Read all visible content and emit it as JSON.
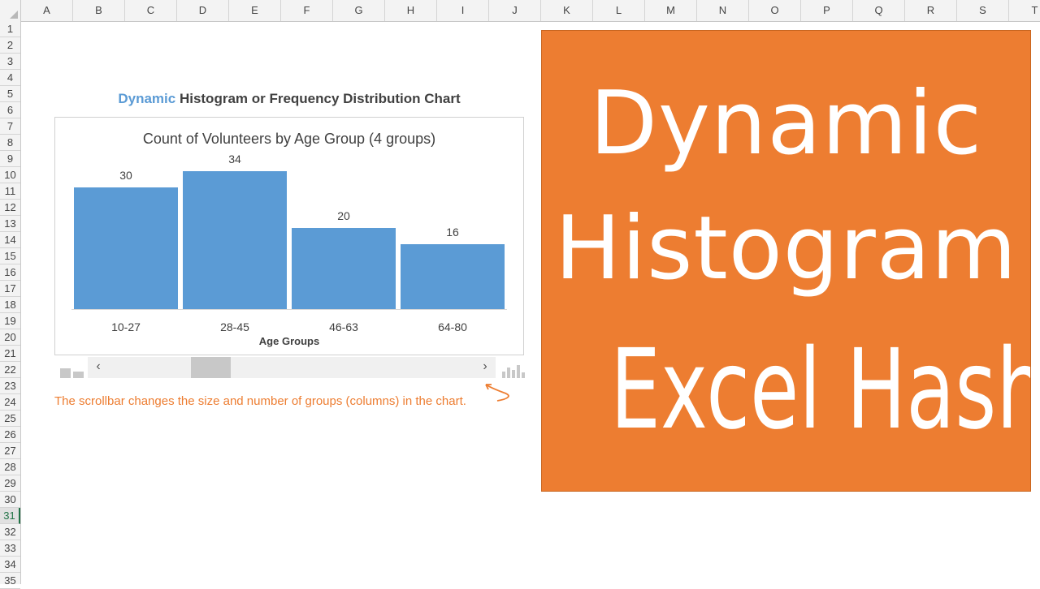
{
  "spreadsheet": {
    "columns": [
      "A",
      "B",
      "C",
      "D",
      "E",
      "F",
      "G",
      "H",
      "I",
      "J",
      "K",
      "L",
      "M",
      "N",
      "O",
      "P",
      "Q",
      "R",
      "S",
      "T"
    ],
    "rows": [
      "1",
      "2",
      "3",
      "4",
      "5",
      "6",
      "7",
      "8",
      "9",
      "10",
      "11",
      "12",
      "13",
      "14",
      "15",
      "16",
      "17",
      "18",
      "19",
      "20",
      "21",
      "22",
      "23",
      "24",
      "25",
      "26",
      "27",
      "28",
      "29",
      "30",
      "31",
      "32",
      "33",
      "34",
      "35"
    ],
    "active_row": "31"
  },
  "heading": {
    "accent": "Dynamic",
    "rest": " Histogram or Frequency Distribution Chart",
    "accent_color": "#5b9bd5",
    "text_color": "#404040"
  },
  "chart_data": {
    "type": "bar",
    "title": "Count of Volunteers by Age Group (4 groups)",
    "xlabel": "Age Groups",
    "ylabel": "",
    "categories": [
      "10-27",
      "28-45",
      "46-63",
      "64-80"
    ],
    "values": [
      30,
      34,
      20,
      16
    ],
    "ylim": [
      0,
      40
    ],
    "bar_color": "#5b9bd5",
    "data_labels": true,
    "grid": false,
    "legend": "none"
  },
  "scrollbar": {
    "left_glyph": "‹",
    "right_glyph": "›",
    "icon_left": "few-columns-icon",
    "icon_right": "many-columns-icon"
  },
  "note": {
    "text": "The scrollbar changes the size and number of groups (columns) in the chart.",
    "color": "#ed7d31"
  },
  "banner": {
    "line1": "Dynamic",
    "line2": "Histogram",
    "line3": "Excel Hash",
    "background": "#ed7d31",
    "text_color": "#ffffff"
  }
}
